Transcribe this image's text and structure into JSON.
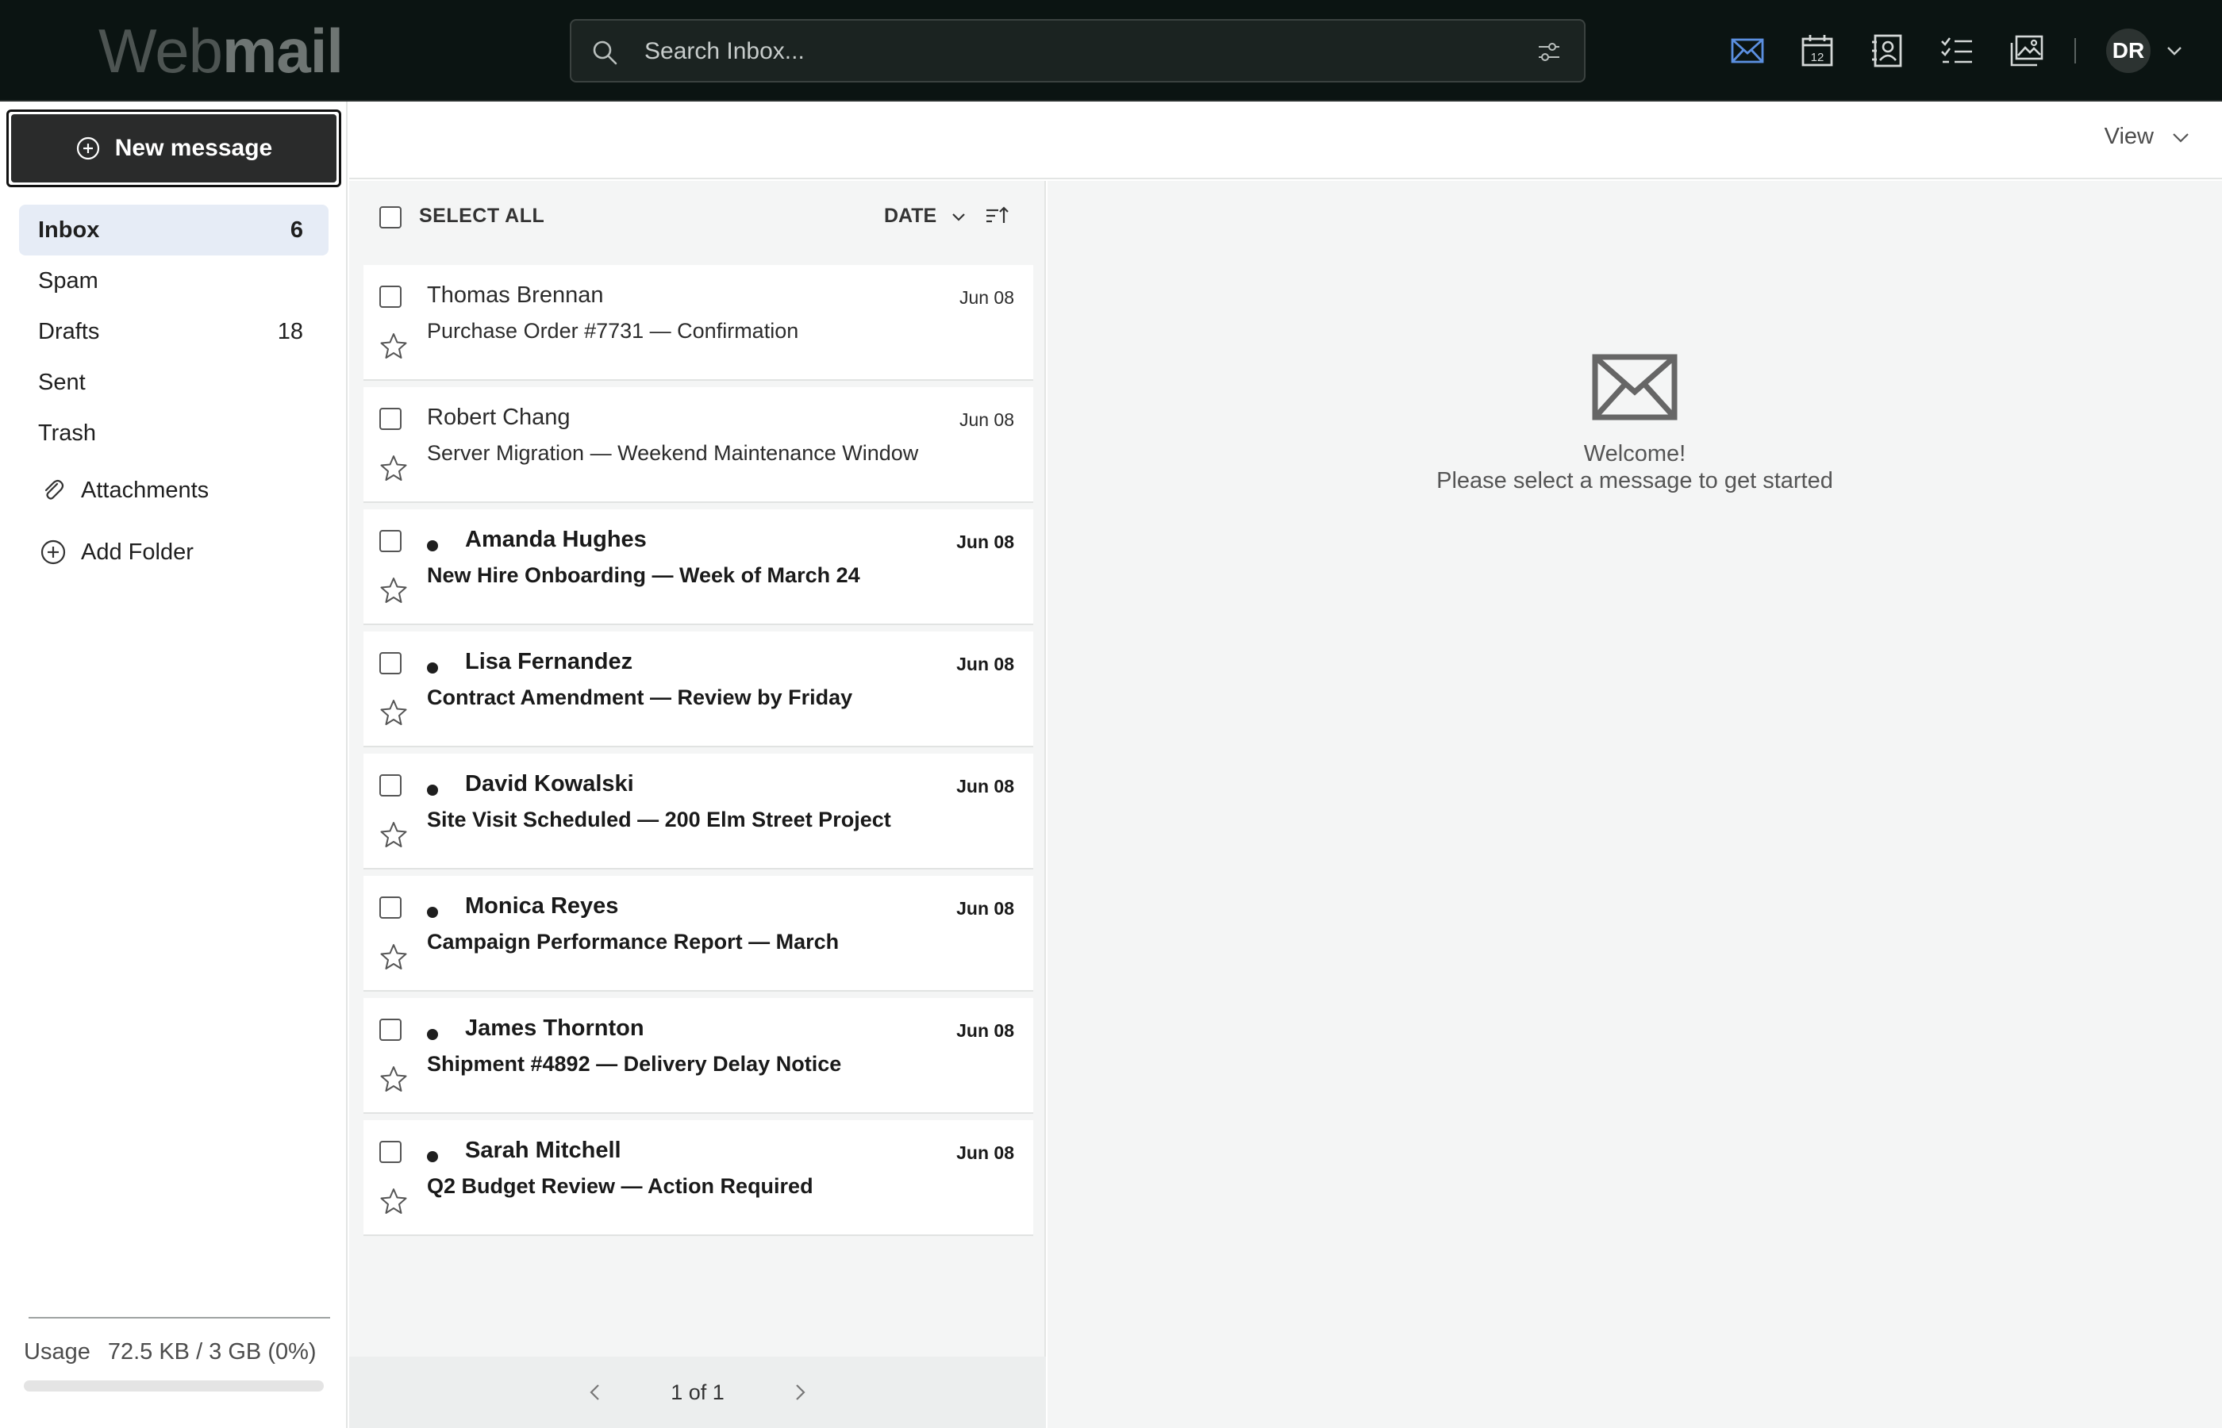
{
  "app": {
    "logo_light": "Web",
    "logo_bold": "mail"
  },
  "search": {
    "placeholder": "Search Inbox..."
  },
  "topnav": {
    "icons": [
      "mail-icon",
      "calendar-icon",
      "contacts-icon",
      "tasks-icon",
      "photos-icon"
    ],
    "calendar_day": "12",
    "user_initials": "DR"
  },
  "sidebar": {
    "new_message_label": "New message",
    "folders": [
      {
        "label": "Inbox",
        "count": "6"
      },
      {
        "label": "Spam",
        "count": ""
      },
      {
        "label": "Drafts",
        "count": "18"
      },
      {
        "label": "Sent",
        "count": ""
      },
      {
        "label": "Trash",
        "count": ""
      }
    ],
    "attachments_label": "Attachments",
    "add_folder_label": "Add Folder",
    "usage_label": "Usage",
    "usage_value": "72.5 KB / 3 GB (0%)",
    "usage_fraction": 0.0
  },
  "view": {
    "label": "View"
  },
  "list": {
    "select_all_label": "SELECT ALL",
    "sort_label": "DATE",
    "messages": [
      {
        "sender": "Thomas Brennan",
        "subject": "Purchase Order #7731 — Confirmation",
        "date": "Jun 08",
        "unread": false
      },
      {
        "sender": "Robert Chang",
        "subject": "Server Migration — Weekend Maintenance Window",
        "date": "Jun 08",
        "unread": false
      },
      {
        "sender": "Amanda Hughes",
        "subject": "New Hire Onboarding — Week of March 24",
        "date": "Jun 08",
        "unread": true
      },
      {
        "sender": "Lisa Fernandez",
        "subject": "Contract Amendment — Review by Friday",
        "date": "Jun 08",
        "unread": true
      },
      {
        "sender": "David Kowalski",
        "subject": "Site Visit Scheduled — 200 Elm Street Project",
        "date": "Jun 08",
        "unread": true
      },
      {
        "sender": "Monica Reyes",
        "subject": "Campaign Performance Report — March",
        "date": "Jun 08",
        "unread": true
      },
      {
        "sender": "James Thornton",
        "subject": "Shipment #4892 — Delivery Delay Notice",
        "date": "Jun 08",
        "unread": true
      },
      {
        "sender": "Sarah Mitchell",
        "subject": "Q2 Budget Review — Action Required",
        "date": "Jun 08",
        "unread": true
      }
    ],
    "pagination": "1 of 1"
  },
  "reading": {
    "welcome_title": "Welcome!",
    "welcome_text": "Please select a message to get started"
  },
  "colors": {
    "topbar_bg": "#0b1412",
    "active_icon": "#5b8fe0",
    "inbox_active_bg": "#e6ecf6",
    "new_message_bg": "#2a2b2b"
  }
}
